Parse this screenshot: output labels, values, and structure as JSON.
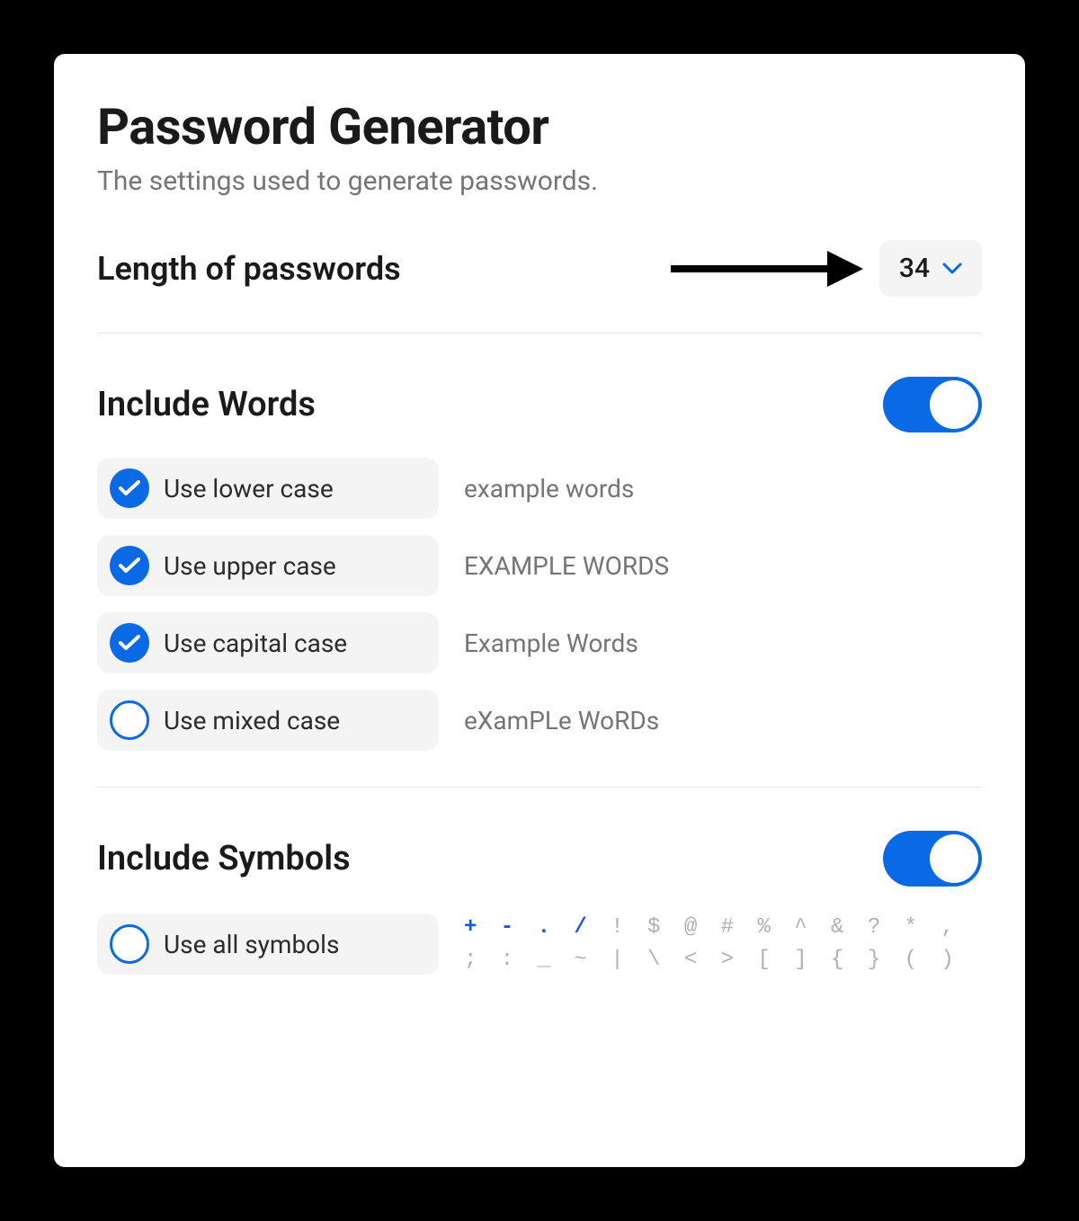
{
  "header": {
    "title": "Password Generator",
    "subtitle": "The settings used to generate passwords."
  },
  "length": {
    "label": "Length of passwords",
    "value": "34"
  },
  "words": {
    "title": "Include Words",
    "toggle": true,
    "options": [
      {
        "label": "Use lower case",
        "example": "example words",
        "checked": true
      },
      {
        "label": "Use upper case",
        "example": "EXAMPLE WORDS",
        "checked": true
      },
      {
        "label": "Use capital case",
        "example": "Example Words",
        "checked": true
      },
      {
        "label": "Use mixed case",
        "example": "eXamPLe WoRDs",
        "checked": false
      }
    ]
  },
  "symbols": {
    "title": "Include Symbols",
    "toggle": true,
    "option_label": "Use all symbols",
    "option_checked": false,
    "highlighted": "+ - . /",
    "rest_line1": " ! $ @ # % ^ & ? * ,",
    "rest_line2": "; : _ ~ | \\ < > [ ] { } ( )"
  },
  "colors": {
    "accent": "#0a6ae6"
  }
}
